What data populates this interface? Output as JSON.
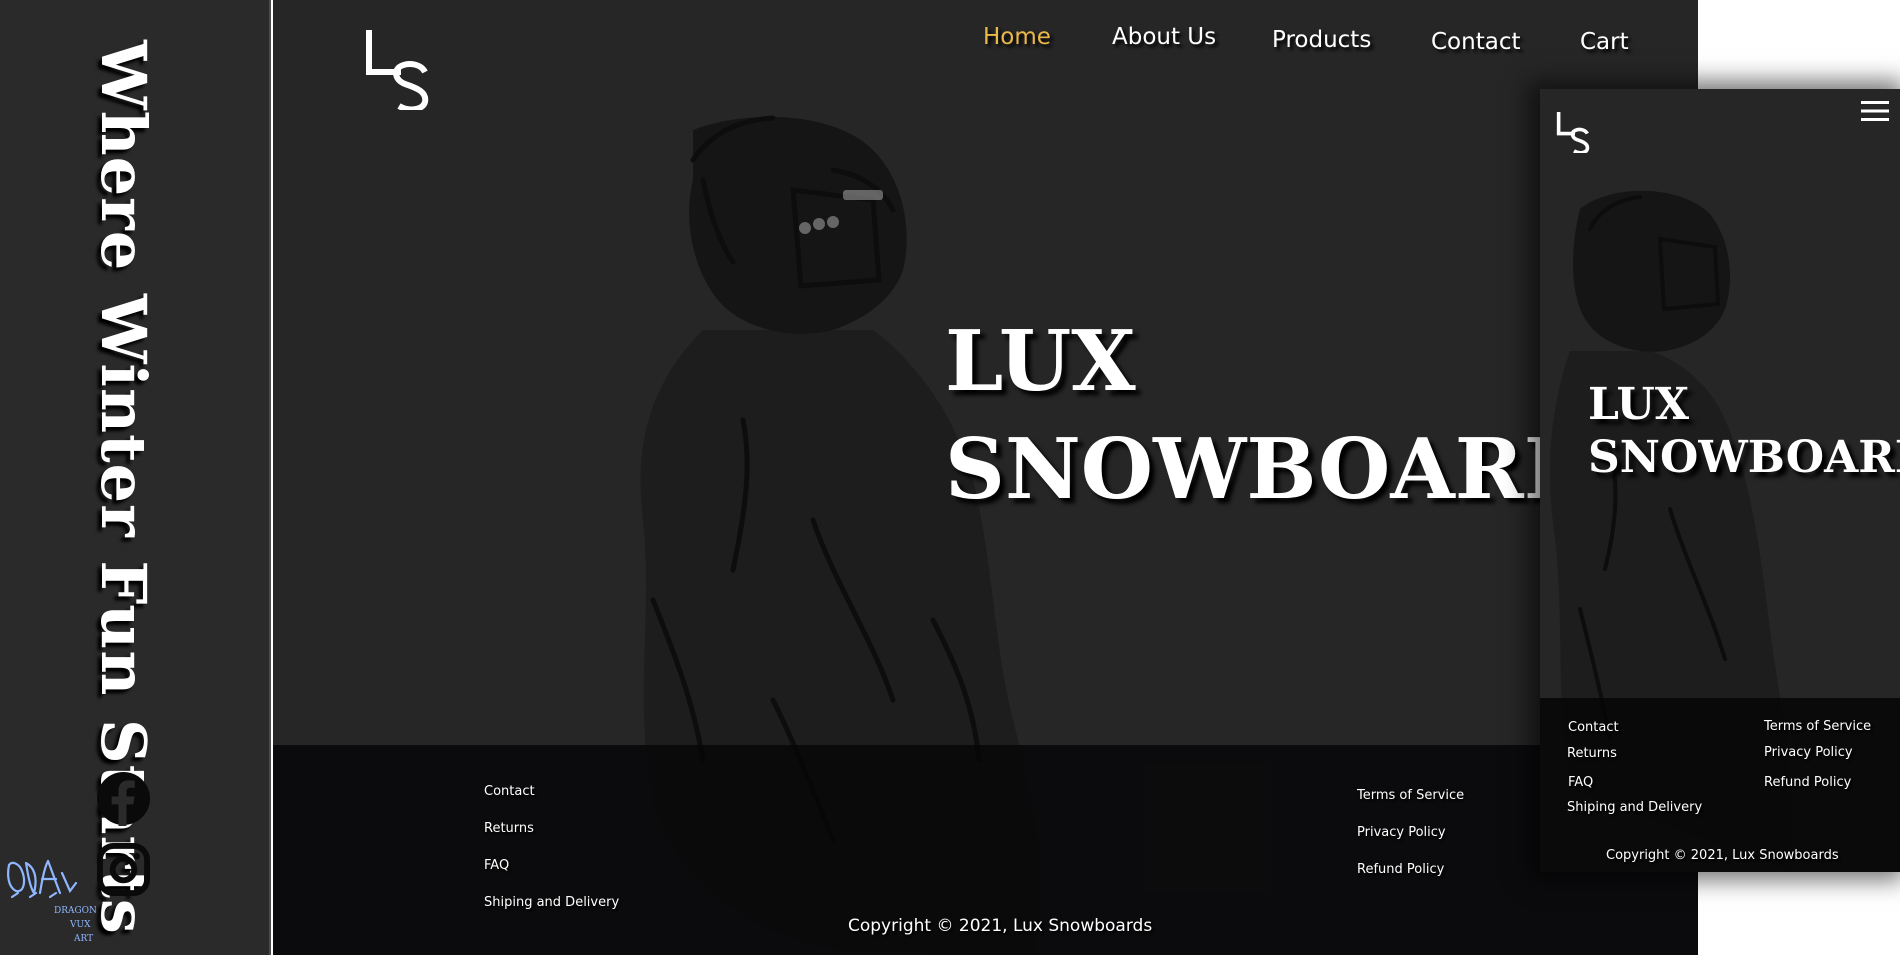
{
  "sidebar": {
    "tagline": "Where Winter Fun Starts",
    "social": [
      "facebook-icon",
      "instagram-icon"
    ],
    "signature_text": "DRAGON VUX ART"
  },
  "brand": {
    "logo_text": "LS",
    "name": "Lux Snowboards"
  },
  "nav": {
    "items": [
      "Home",
      "About Us",
      "Products",
      "Contact",
      "Cart"
    ],
    "active": "Home"
  },
  "hero": {
    "line1": "LUX",
    "line2": "SNOWBOARDS"
  },
  "footer": {
    "left_links": [
      "Contact",
      "Returns",
      "FAQ",
      "Shiping and Delivery"
    ],
    "right_links": [
      "Terms of Service",
      "Privacy Policy",
      "Refund Policy"
    ],
    "copyright": "Copyright © 2021, Lux Snowboards"
  },
  "mobile": {
    "menu_icon": "hamburger-icon"
  },
  "colors": {
    "background": "#262627",
    "sidebar": "#2a2a2b",
    "footer": "#080809",
    "active_nav": "#e8b84a",
    "text": "#ffffff"
  }
}
